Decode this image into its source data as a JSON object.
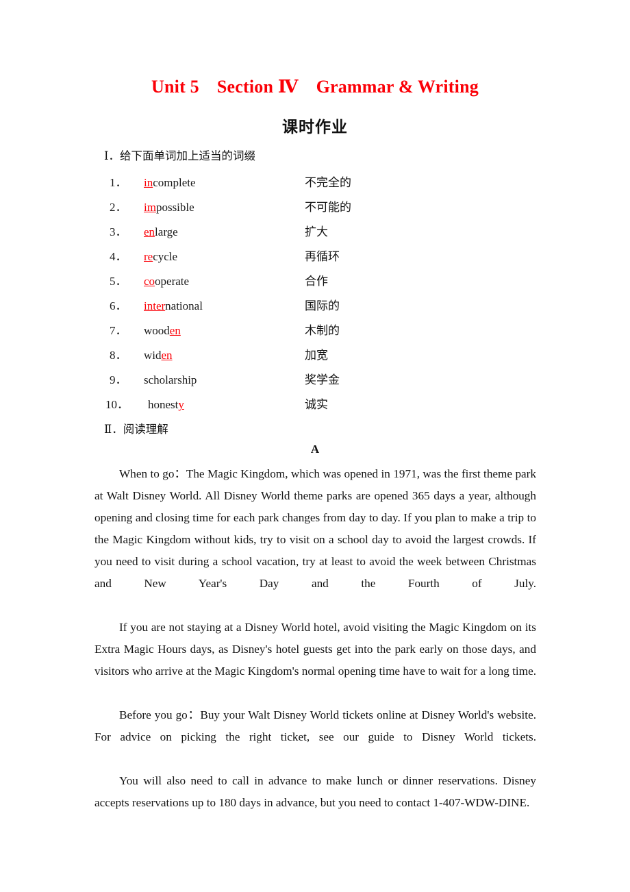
{
  "title": {
    "unit": "Unit 5",
    "section": "Section Ⅳ",
    "topic": "Grammar & Writing",
    "color": "#fb0007"
  },
  "subtitle": "课时作业",
  "sections": [
    {
      "id": "I",
      "numeral": "Ⅰ",
      "separator": "．",
      "heading": "给下面单词加上适当的词缀"
    },
    {
      "id": "II",
      "numeral": "Ⅱ",
      "separator": "．",
      "heading": "阅读理解"
    }
  ],
  "vocabulary": {
    "items": [
      {
        "index": "1．",
        "prefix": "in",
        "rest": "complete",
        "suffix": "",
        "cn": "不完全的"
      },
      {
        "index": "2．",
        "prefix": "im",
        "rest": "possible",
        "suffix": "",
        "cn": "不可能的"
      },
      {
        "index": "3．",
        "prefix": "en",
        "rest": "large",
        "suffix": "",
        "cn": "扩大"
      },
      {
        "index": "4．",
        "prefix": "re",
        "rest": "cycle",
        "suffix": "",
        "cn": "再循环"
      },
      {
        "index": "5．",
        "prefix": "co",
        "rest": "operate",
        "suffix": "",
        "cn": "合作"
      },
      {
        "index": "6．",
        "prefix": "inter",
        "rest": "national",
        "suffix": "",
        "cn": "国际的"
      },
      {
        "index": "7．",
        "prefix": "",
        "rest": "wood",
        "suffix": "en",
        "cn": "木制的"
      },
      {
        "index": "8．",
        "prefix": "",
        "rest": "wid",
        "suffix": "en",
        "cn": "加宽"
      },
      {
        "index": "9．",
        "prefix": "",
        "rest": "scholarship",
        "suffix": "",
        "cn": "奖学金"
      },
      {
        "index": "10．",
        "prefix": "",
        "rest": "honest",
        "suffix": "y",
        "cn": "诚实"
      }
    ]
  },
  "passage": {
    "label": "A",
    "paragraphs": [
      "When to go：The Magic Kingdom, which was opened in 1971, was the first theme park at Walt Disney World. All Disney World theme parks are opened 365 days a year, although opening and closing time for each park changes from day to day. If you plan to make a trip to the Magic Kingdom without kids, try to visit on a school day to avoid the largest crowds. If you need to visit during a school vacation, try at least to avoid the week between Christmas and New Year's Day and the Fourth of July.",
      "If you are not staying at a Disney World hotel, avoid visiting the Magic Kingdom on its Extra Magic Hours days, as Disney's hotel guests get into the park early on those days, and visitors who arrive at the Magic Kingdom's normal opening time have to wait for a long time.",
      "Before you go：Buy your Walt Disney World tickets online at Disney World's website. For advice on picking the right ticket, see our guide to Disney World tickets.",
      "You will also need to call in advance to make lunch or dinner reservations. Disney accepts reservations up to 180 days in advance, but you need to contact 1-407-WDW-DINE."
    ]
  }
}
